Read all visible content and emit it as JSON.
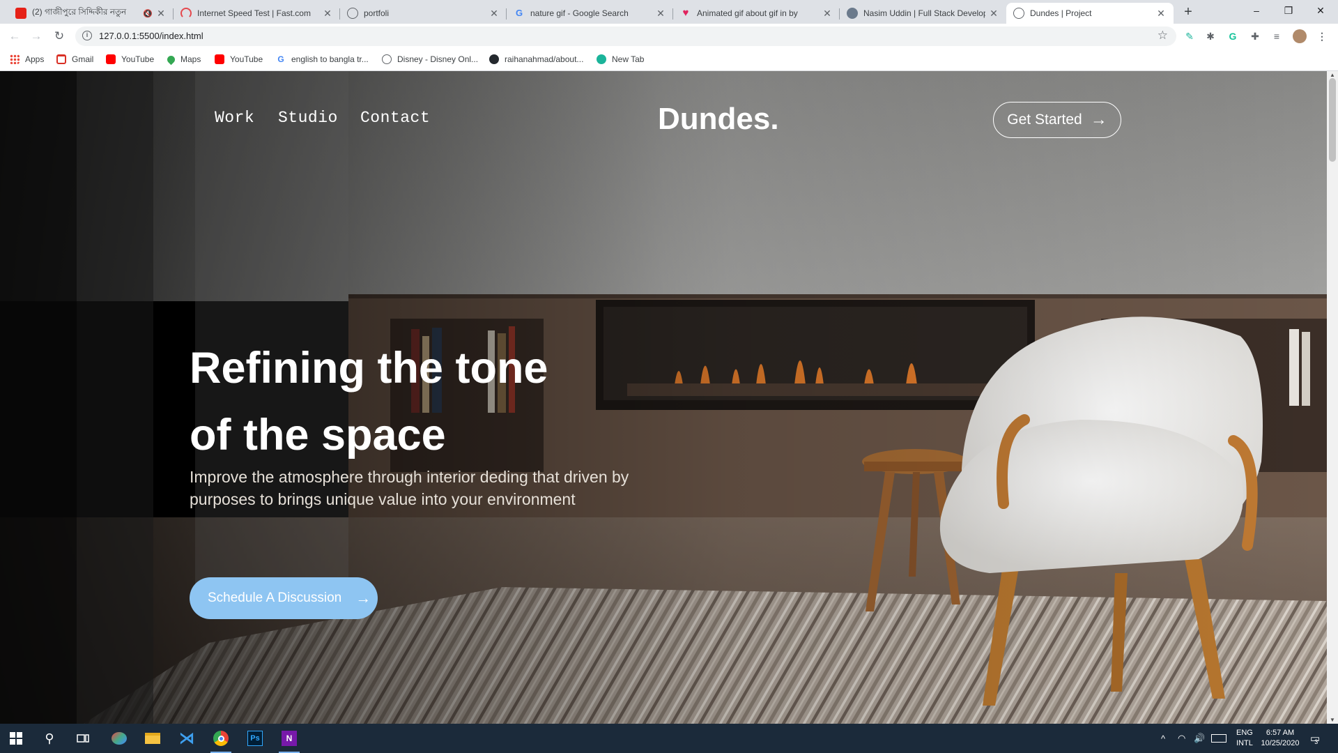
{
  "browser": {
    "tabs": [
      {
        "title": "(2) গাজীপুরে সিদ্দিকীর নতুন",
        "favicon_color": "#e62117",
        "muted": true
      },
      {
        "title": "Internet Speed Test | Fast.com",
        "favicon_color": "#e5484d"
      },
      {
        "title": "portfoli",
        "favicon_color": "#5f6368"
      },
      {
        "title": "nature gif - Google Search",
        "favicon_color": "#4285f4"
      },
      {
        "title": "Animated gif about gif in  by",
        "favicon_color": "#e0245e"
      },
      {
        "title": "Nasim Uddin | Full Stack Develop",
        "favicon_color": "#6b7a8c"
      },
      {
        "title": "Dundes | Project",
        "favicon_color": "#5f6368",
        "active": true
      }
    ],
    "new_tab_icon": "plus-icon",
    "window_controls": {
      "minimize": "–",
      "maximize": "❐",
      "close": "✕"
    },
    "address": "127.0.0.1:5500/index.html",
    "bookmarks": [
      {
        "label": "Apps",
        "icon_color": "#ea4335"
      },
      {
        "label": "Gmail",
        "icon_color": "#d93025"
      },
      {
        "label": "YouTube",
        "icon_color": "#ff0000"
      },
      {
        "label": "Maps",
        "icon_color": "#34a853"
      },
      {
        "label": "YouTube",
        "icon_color": "#ff0000"
      },
      {
        "label": "english to bangla tr...",
        "icon_color": "#4285f4"
      },
      {
        "label": "Disney - Disney Onl...",
        "icon_color": "#5f6368"
      },
      {
        "label": "raihanahmad/about...",
        "icon_color": "#24292e"
      },
      {
        "label": "New Tab",
        "icon_color": "#1bb49a"
      }
    ]
  },
  "page": {
    "nav": {
      "work": "Work",
      "studio": "Studio",
      "contact": "Contact"
    },
    "logo": "Dundes.",
    "get_started": "Get Started",
    "hero_title_line1": "Refining the tone",
    "hero_title_line2": "of the space",
    "hero_subtitle_line1": "Improve the atmosphere through interior deding that driven by",
    "hero_subtitle_line2": "purposes to brings unique value into your environment",
    "schedule_button": "Schedule A Discussion",
    "accent_color": "#8ec5f2"
  },
  "taskbar": {
    "language_top": "ENG",
    "language_bottom": "INTL",
    "time": "6:57 AM",
    "date": "10/25/2020",
    "notification_count": "3"
  }
}
